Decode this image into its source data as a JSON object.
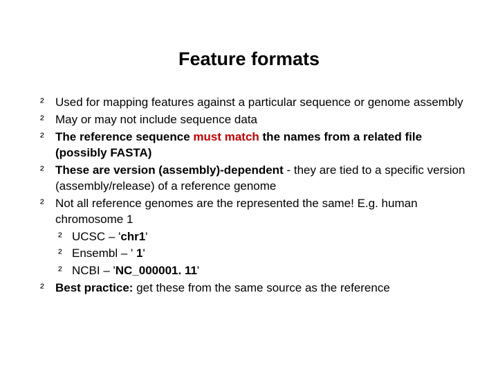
{
  "title": "Feature formats",
  "items": {
    "i0": "Used for mapping features against a particular sequence or genome assembly",
    "i1": "May or may not include sequence data",
    "i2a": "The reference sequence ",
    "i2b": "must match",
    "i2c": " the names from a related file (possibly FASTA)",
    "i3a": "These are version (assembly)-dependent",
    "i3b": " - they are tied to a specific version (assembly/release) of a reference genome",
    "i4": "Not all reference genomes are the represented the same! E.g. human chromosome 1",
    "i4_sub": {
      "s0a": "UCSC – '",
      "s0b": "chr1",
      "s0c": "'",
      "s1a": "Ensembl – '",
      "s1b": " 1",
      "s1c": "'",
      "s2a": "NCBI – '",
      "s2b": "NC_000001. 11",
      "s2c": "'"
    },
    "i5a": "Best practice:",
    "i5b": " get these from the same source as the reference"
  }
}
